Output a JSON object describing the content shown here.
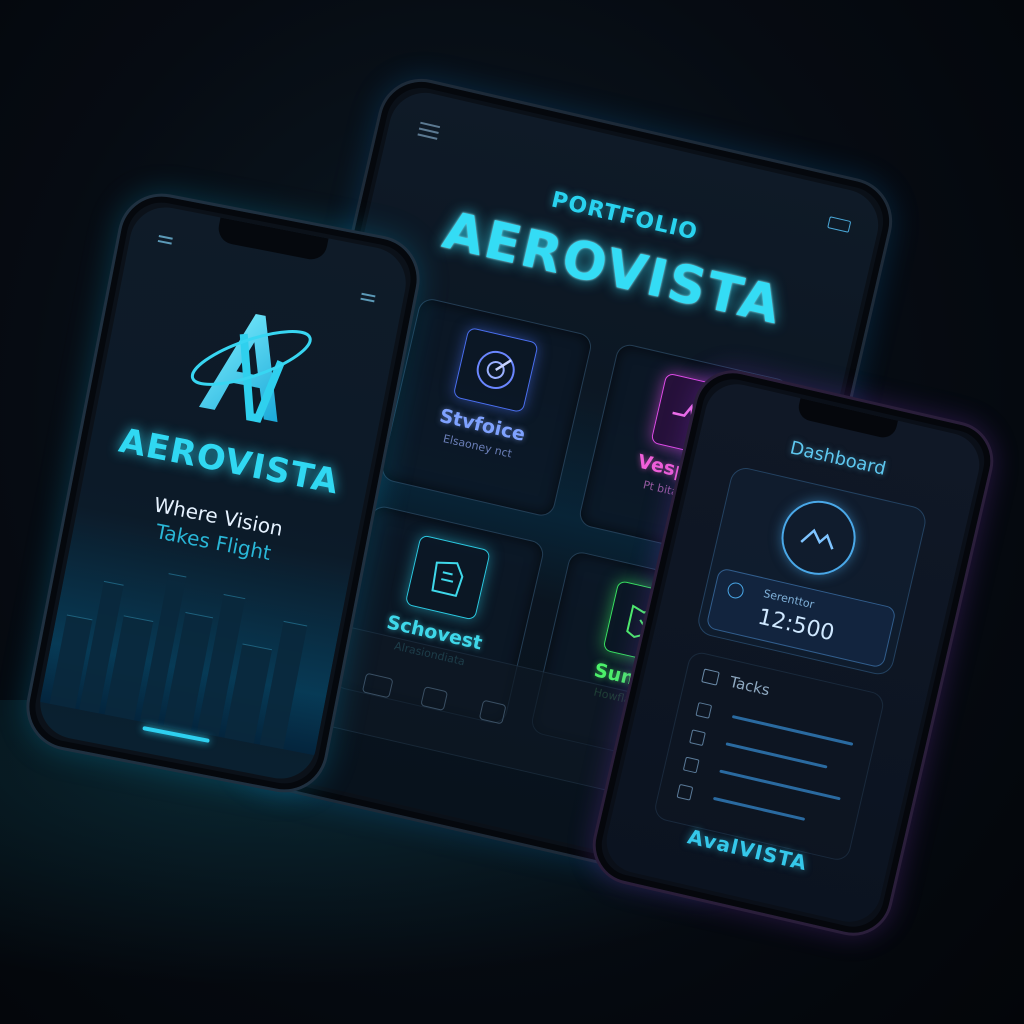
{
  "colors": {
    "accent_cyan": "#34dcf5",
    "accent_pink": "#f05fd9",
    "accent_green": "#4cf06a",
    "accent_blue": "#7fa2ff"
  },
  "left_phone": {
    "logo_icon": "av-monogram-icon",
    "brand": "AEROVISTA",
    "tagline_line1": "Where Vision",
    "tagline_line2": "Takes Flight"
  },
  "tablet": {
    "kicker": "PORTFOLIO",
    "brand": "AEROVISTA",
    "tiles": [
      {
        "name": "Stvfoice",
        "sub": "Elsaoney nct",
        "icon": "target-icon"
      },
      {
        "name": "Vespere",
        "sub": "Pt bitamnus",
        "icon": "pulse-icon"
      },
      {
        "name": "Schovest",
        "sub": "Alrasiondiata",
        "icon": "document-icon"
      },
      {
        "name": "Sunn:lt",
        "sub": "Howflaname",
        "icon": "map-icon"
      }
    ]
  },
  "right_phone": {
    "title": "Dashboard",
    "metric_label": "Serenttor",
    "metric_value": "12:500",
    "tasks_title": "Tacks",
    "brand": "AvalVISTA"
  }
}
